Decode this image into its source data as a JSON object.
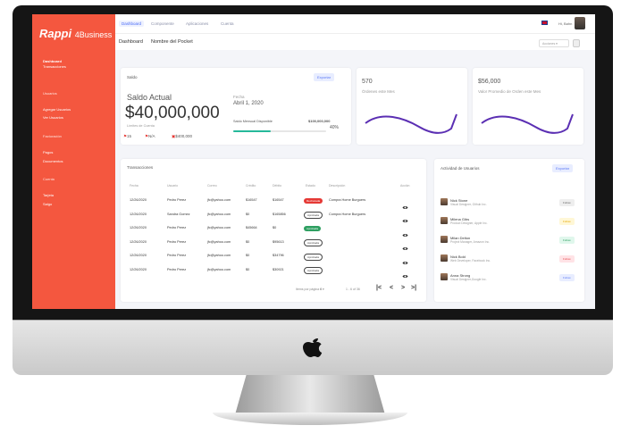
{
  "sidebar": {
    "logo_brand": "Rappi",
    "logo_suffix": "4Business",
    "items": [
      {
        "label": "Dashboard",
        "type": "active"
      },
      {
        "label": "Transacciones",
        "type": "item"
      },
      {
        "label": "Usuarios",
        "type": "head"
      },
      {
        "label": "Agregar Usuarios",
        "type": "item"
      },
      {
        "label": "Ver Usuarios",
        "type": "item"
      },
      {
        "label": "Facturación",
        "type": "head"
      },
      {
        "label": "Pagos",
        "type": "item"
      },
      {
        "label": "Documentos",
        "type": "item"
      },
      {
        "label": "Cuenta",
        "type": "head"
      },
      {
        "label": "Tarjeta",
        "type": "item"
      },
      {
        "label": "Salgo",
        "type": "item"
      }
    ]
  },
  "topbar": {
    "tabs": [
      "Dashboard",
      "Componente",
      "Aplicaciones",
      "Cuenta"
    ],
    "user_label": "Hi, Bahn"
  },
  "subbar": {
    "crumb_a": "Dashboard",
    "crumb_b": "Nombre del Pocket",
    "select_label": "Acciones"
  },
  "saldo_card": {
    "title": "Saldo",
    "button": "Exportar",
    "subtitle": "Saldo Actual",
    "amount": "$40,000,000",
    "caption": "Límites de Cuenta",
    "fecha_label": "Fecha",
    "fecha_value": "Abril 1, 2020",
    "mensual_label": "Saldo Mensual Disponible",
    "mensual_value": "$100,000,000",
    "mensual_pct": "40%",
    "progress": 0.4,
    "chip_1": "15",
    "chip_2": "N/A",
    "chip_3": "$400,000"
  },
  "metric_1": {
    "value": "570",
    "label": "Órdenes este Mes"
  },
  "metric_2": {
    "value": "$56,000",
    "label": "Valor Promedio de Orden este Mes"
  },
  "transactions": {
    "title": "Transacciones",
    "headers": [
      "Fecha",
      "Usuario",
      "Correo",
      "Crédito",
      "Débito",
      "Estado",
      "Descripción",
      "Acción"
    ],
    "rows": [
      {
        "fecha": "12/26/2020",
        "usuario": "Pedro Perez",
        "correo": "jfc@yahoo.com",
        "credito": "$16547",
        "debito": "$16547",
        "estado": "Rechazada",
        "estado_type": "red",
        "desc": "Compra Home Burguers"
      },
      {
        "fecha": "12/26/2020",
        "usuario": "Sandra Gomez",
        "correo": "jfc@yahoo.com",
        "credito": "$0",
        "debito": "$165856",
        "estado": "Aprobada",
        "estado_type": "outline",
        "desc": "Compra Home Burguers"
      },
      {
        "fecha": "12/26/2020",
        "usuario": "Pedro Perez",
        "correo": "jfc@yahoo.com",
        "credito": "$45664",
        "debito": "$0",
        "estado": "Aprobada",
        "estado_type": "green",
        "desc": ""
      },
      {
        "fecha": "12/26/2020",
        "usuario": "Pedro Perez",
        "correo": "jfc@yahoo.com",
        "credito": "$0",
        "debito": "$95613",
        "estado": "Aprobada",
        "estado_type": "outline",
        "desc": ""
      },
      {
        "fecha": "12/26/2020",
        "usuario": "Pedro Perez",
        "correo": "jfc@yahoo.com",
        "credito": "$0",
        "debito": "$34796",
        "estado": "Aprobada",
        "estado_type": "outline",
        "desc": ""
      },
      {
        "fecha": "12/26/2020",
        "usuario": "Pedro Perez",
        "correo": "jfc@yahoo.com",
        "credito": "$0",
        "debito": "$30921",
        "estado": "Aprobada",
        "estado_type": "outline",
        "desc": ""
      }
    ],
    "pager_rows_label": "Items por página",
    "pager_rows_value": "6",
    "pager_range": "1 - 6 of 36"
  },
  "activity": {
    "title": "Actividad de Usuarios",
    "button": "Exportar",
    "items": [
      {
        "name": "Nick Stone",
        "sub": "Visual Designer, Github Inc.",
        "btn": "Follow",
        "btn_bg": "#eeeeee",
        "btn_color": "#666666"
      },
      {
        "name": "Milena Gibs",
        "sub": "Product Designer, Apple Inc.",
        "btn": "Follow",
        "btn_bg": "#fff7d6",
        "btn_color": "#e6a800"
      },
      {
        "name": "Milan Delton",
        "sub": "Project Manager, Amazon Inc.",
        "btn": "Follow",
        "btn_bg": "#e0f7ec",
        "btn_color": "#2e9f61"
      },
      {
        "name": "Nick Bold",
        "sub": "Web Developer, Facebook Inc.",
        "btn": "Follow",
        "btn_bg": "#ffe3e6",
        "btn_color": "#e5484d"
      },
      {
        "name": "Anna Strong",
        "sub": "Visual Designer,Google Inc.",
        "btn": "Follow",
        "btn_bg": "#e8edff",
        "btn_color": "#5b79f5"
      }
    ]
  },
  "colors": {
    "sidebar": "#f4573f",
    "accent": "#4a6cf7",
    "chart_line": "#5b2fb3"
  }
}
